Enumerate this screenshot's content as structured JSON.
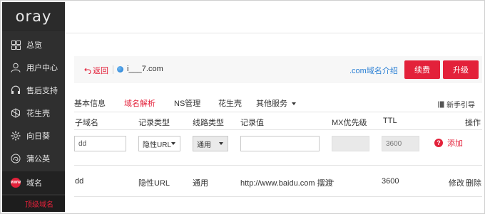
{
  "logo": "oray",
  "sidebar": {
    "items": [
      {
        "label": "总览",
        "icon": "grid-icon"
      },
      {
        "label": "用户中心",
        "icon": "user-icon"
      },
      {
        "label": "售后支持",
        "icon": "support-icon"
      },
      {
        "label": "花生壳",
        "icon": "peanut-shell-icon"
      },
      {
        "label": "向日葵",
        "icon": "sunflower-icon"
      },
      {
        "label": "蒲公英",
        "icon": "dandelion-icon"
      },
      {
        "label": "域名",
        "icon": "www-icon"
      }
    ],
    "sub_item": "顶级域名",
    "badge_text": "WWW"
  },
  "info": {
    "back": "返回",
    "domain": "i___7.com",
    "intro_link": ".com域名介绍",
    "renew": "续费",
    "upgrade": "升级"
  },
  "tabs": [
    "基本信息",
    "域名解析",
    "NS管理",
    "花生壳",
    "其他服务"
  ],
  "guide": "新手引导",
  "table": {
    "headers": [
      "子域名",
      "记录类型",
      "线路类型",
      "记录值",
      "MX优先级",
      "TTL",
      "操作"
    ],
    "form": {
      "subdomain": "dd",
      "record_type": "隐性URL",
      "line_type": "通用",
      "record_value": "",
      "mx": "",
      "ttl": "3600",
      "add": "添加",
      "help": "?"
    },
    "row": {
      "subdomain": "dd",
      "record_type": "隐性URL",
      "line_type": "通用",
      "record_value": "http://www.baidu.com 摆渡",
      "mx": "-",
      "ttl": "3600",
      "edit": "修改",
      "delete": "删除"
    }
  },
  "colors": {
    "accent": "#e3213a",
    "sidebar": "#2f2f2f",
    "link": "#2a7fd4"
  }
}
